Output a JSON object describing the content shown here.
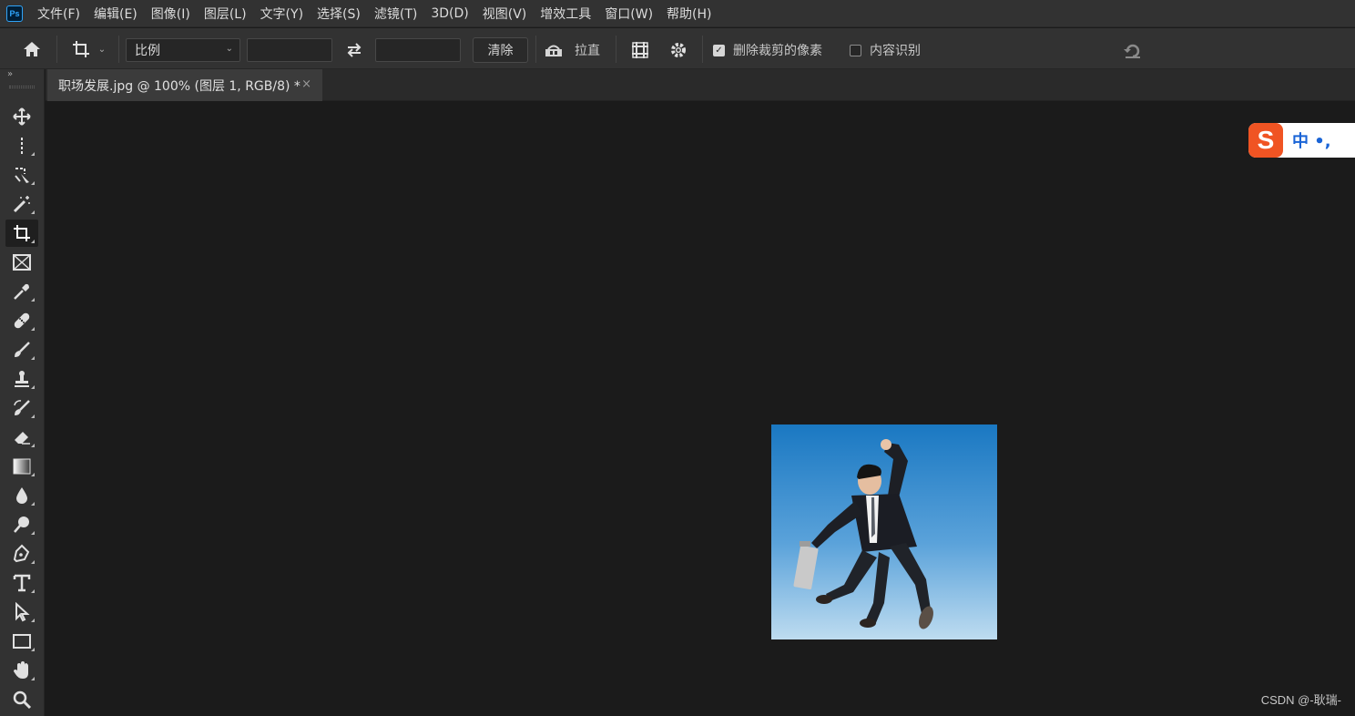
{
  "app": {
    "logo_text": "Ps"
  },
  "menu": [
    "文件(F)",
    "编辑(E)",
    "图像(I)",
    "图层(L)",
    "文字(Y)",
    "选择(S)",
    "滤镜(T)",
    "3D(D)",
    "视图(V)",
    "增效工具",
    "窗口(W)",
    "帮助(H)"
  ],
  "options": {
    "ratio_value": "比例",
    "width_value": "",
    "height_value": "",
    "clear_label": "清除",
    "straighten_label": "拉直",
    "delete_cropped_label": "删除裁剪的像素",
    "delete_cropped_checked": true,
    "content_aware_label": "内容识别",
    "content_aware_checked": false
  },
  "document": {
    "tab_title": "职场发展.jpg @ 100% (图层 1, RGB/8) *",
    "close_glyph": "×"
  },
  "tools": [
    "move-tool-icon",
    "rectangular-marquee-tool-icon",
    "object-selection-tool-icon",
    "magic-wand-tool-icon",
    "crop-tool-icon",
    "frame-tool-icon",
    "eyedropper-tool-icon",
    "healing-brush-tool-icon",
    "brush-tool-icon",
    "clone-stamp-tool-icon",
    "history-brush-tool-icon",
    "eraser-tool-icon",
    "gradient-tool-icon",
    "blur-tool-icon",
    "dodge-tool-icon",
    "pen-tool-icon",
    "type-tool-icon",
    "path-selection-tool-icon",
    "rectangle-tool-icon",
    "hand-tool-icon",
    "zoom-tool-icon"
  ],
  "active_tool": "crop-tool-icon",
  "ime": {
    "logo": "S",
    "text": "中 •, "
  },
  "watermark": "CSDN @-耿瑞-",
  "colors": {
    "accent": "#31a8ff",
    "panel": "#323232",
    "canvas": "#1b1b1b",
    "ime_brand": "#f05423"
  }
}
